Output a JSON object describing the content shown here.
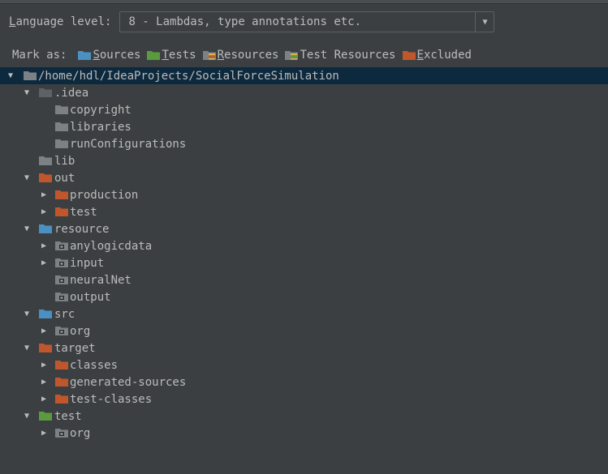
{
  "language_level": {
    "label_underlined": "L",
    "label_rest": "anguage level:",
    "value": "8 - Lambdas, type annotations etc.",
    "arrow": "▼"
  },
  "mark_as": {
    "label": "Mark as:",
    "items": [
      {
        "u": "S",
        "rest": "ources",
        "icon": "folder-blue-icon"
      },
      {
        "u": "T",
        "rest": "ests",
        "icon": "folder-green-icon"
      },
      {
        "u": "R",
        "rest": "esources",
        "icon": "folder-resources-icon"
      },
      {
        "u": "",
        "rest": "Test Resources",
        "icon": "folder-test-resources-icon"
      },
      {
        "u": "E",
        "rest": "xcluded",
        "icon": "folder-orange-icon"
      }
    ]
  },
  "colors": {
    "gray": "#7b8185",
    "blue": "#4a90c2",
    "green": "#5c9a3f",
    "orange": "#c0572c",
    "selected_row": "#0d293e"
  },
  "tree": [
    {
      "label": "/home/hdl/IdeaProjects/SocialForceSimulation",
      "depth": 0,
      "arrow": "▼",
      "type": "gray",
      "selected": true
    },
    {
      "label": ".idea",
      "depth": 1,
      "arrow": "▼",
      "type": "gray-dark"
    },
    {
      "label": "copyright",
      "depth": 2,
      "arrow": "",
      "type": "gray"
    },
    {
      "label": "libraries",
      "depth": 2,
      "arrow": "",
      "type": "gray"
    },
    {
      "label": "runConfigurations",
      "depth": 2,
      "arrow": "",
      "type": "gray"
    },
    {
      "label": "lib",
      "depth": 1,
      "arrow": "",
      "type": "gray"
    },
    {
      "label": "out",
      "depth": 1,
      "arrow": "▼",
      "type": "orange"
    },
    {
      "label": "production",
      "depth": 2,
      "arrow": "▶",
      "type": "orange"
    },
    {
      "label": "test",
      "depth": 2,
      "arrow": "▶",
      "type": "orange"
    },
    {
      "label": "resource",
      "depth": 1,
      "arrow": "▼",
      "type": "blue"
    },
    {
      "label": "anylogicdata",
      "depth": 2,
      "arrow": "▶",
      "type": "package"
    },
    {
      "label": "input",
      "depth": 2,
      "arrow": "▶",
      "type": "package"
    },
    {
      "label": "neuralNet",
      "depth": 2,
      "arrow": "",
      "type": "package"
    },
    {
      "label": "output",
      "depth": 2,
      "arrow": "",
      "type": "package"
    },
    {
      "label": "src",
      "depth": 1,
      "arrow": "▼",
      "type": "blue"
    },
    {
      "label": "org",
      "depth": 2,
      "arrow": "▶",
      "type": "package"
    },
    {
      "label": "target",
      "depth": 1,
      "arrow": "▼",
      "type": "orange"
    },
    {
      "label": "classes",
      "depth": 2,
      "arrow": "▶",
      "type": "orange"
    },
    {
      "label": "generated-sources",
      "depth": 2,
      "arrow": "▶",
      "type": "orange"
    },
    {
      "label": "test-classes",
      "depth": 2,
      "arrow": "▶",
      "type": "orange"
    },
    {
      "label": "test",
      "depth": 1,
      "arrow": "▼",
      "type": "green"
    },
    {
      "label": "org",
      "depth": 2,
      "arrow": "▶",
      "type": "package"
    }
  ]
}
